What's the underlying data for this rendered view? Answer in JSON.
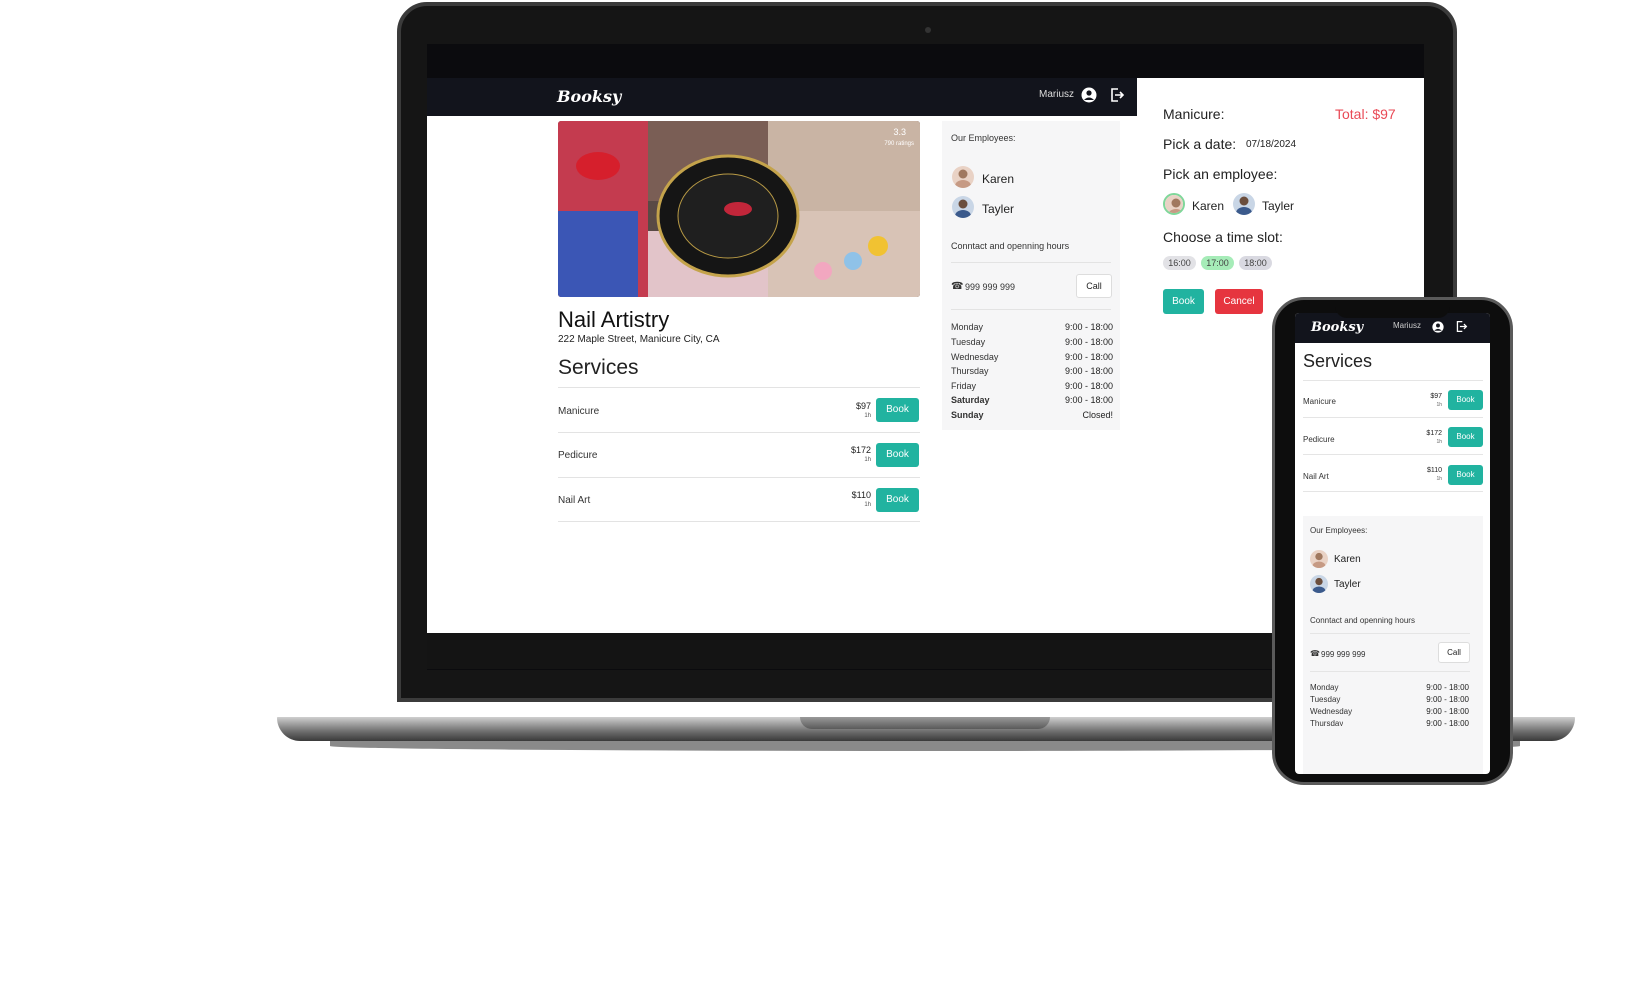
{
  "app": {
    "brand": "Booksy",
    "user_name": "Mariusz"
  },
  "salon": {
    "name": "Nail Artistry",
    "address": "222 Maple Street, Manicure City, CA",
    "rating": "3.3",
    "rating_count": "790 ratings"
  },
  "services": {
    "title": "Services",
    "items": [
      {
        "name": "Manicure",
        "price": "$97",
        "duration": "1h",
        "button": "Book"
      },
      {
        "name": "Pedicure",
        "price": "$172",
        "duration": "1h",
        "button": "Book"
      },
      {
        "name": "Nail Art",
        "price": "$110",
        "duration": "1h",
        "button": "Book"
      }
    ]
  },
  "info": {
    "employees_label": "Our Employees:",
    "employees": [
      "Karen",
      "Tayler"
    ],
    "contact_label": "Conntact and openning hours",
    "phone": "999 999 999",
    "call_button": "Call",
    "hours": [
      {
        "day": "Monday",
        "time": "9:00 - 18:00"
      },
      {
        "day": "Tuesday",
        "time": "9:00 - 18:00"
      },
      {
        "day": "Wednesday",
        "time": "9:00 - 18:00"
      },
      {
        "day": "Thursday",
        "time": "9:00 - 18:00"
      },
      {
        "day": "Friday",
        "time": "9:00 - 18:00"
      },
      {
        "day": "Saturday",
        "time": "9:00 - 18:00"
      },
      {
        "day": "Sunday",
        "time": "Closed!"
      }
    ]
  },
  "booking": {
    "service_label": "Manicure:",
    "total": "Total: $97",
    "date_label": "Pick a date:",
    "date_value": "07/18/2024",
    "employee_label": "Pick an employee:",
    "employees": [
      "Karen",
      "Tayler"
    ],
    "selected_employee": "Karen",
    "slot_label": "Choose a time slot:",
    "slots": [
      "16:00",
      "17:00",
      "18:00"
    ],
    "selected_slot": "17:00",
    "book_button": "Book",
    "cancel_button": "Cancel"
  },
  "phone": {
    "user_name": "Mariusz",
    "visible_hours": [
      {
        "day": "Monday",
        "time": "9:00 - 18:00"
      },
      {
        "day": "Tuesday",
        "time": "9:00 - 18:00"
      },
      {
        "day": "Wednesday",
        "time": "9:00 - 18:00"
      },
      {
        "day": "Thursday",
        "time": "9:00 - 18:00"
      }
    ]
  },
  "colors": {
    "accent_teal": "#21b3a0",
    "danger_red": "#e6353f",
    "total_red": "#e94a56",
    "slot_selected": "#a6ecb8",
    "navbar": "#12141c"
  }
}
